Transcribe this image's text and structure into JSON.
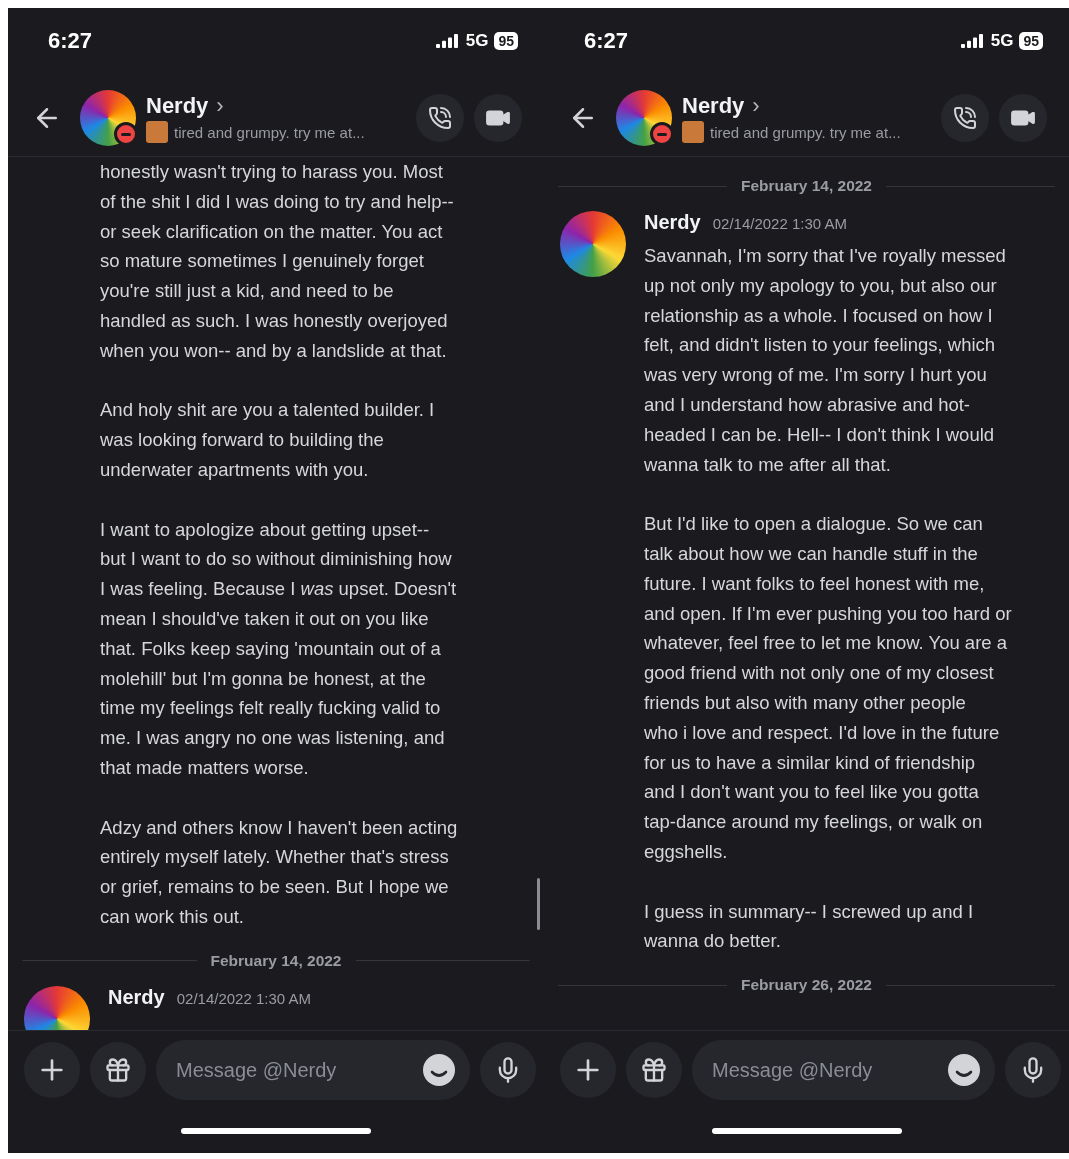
{
  "screens": [
    {
      "status_bar": {
        "time": "6:27",
        "network": "5G",
        "battery": "95"
      },
      "header": {
        "name": "Nerdy",
        "chevron": "›",
        "status": "tired and grumpy. try me at..."
      },
      "feed": [
        {
          "kind": "paragraphs",
          "paragraphs": [
            "honestly wasn't trying to harass you. Most\nof the shit I did I was doing to try and help--\nor seek clarification on the matter. You act\nso mature sometimes I genuinely forget\nyou're still just a kid, and need to be\nhandled as such. I was honestly overjoyed\nwhen you won-- and by a landslide at that.",
            "And holy shit are you a talented builder. I\nwas looking forward to building the\nunderwater apartments with you.",
            "I want to apologize about getting upset--\nbut I want to do so without diminishing how\nI was feeling. Because I *was* upset. Doesn't\nmean I should've taken it out on you like\nthat. Folks keep saying 'mountain out of a\nmolehill' but I'm gonna be honest, at the\ntime my feelings felt really fucking valid to\nme. I was angry no one was listening, and\nthat made matters worse.",
            "Adzy and others know I haven't been acting\nentirely myself lately. Whether that's stress\nor grief, remains to be seen. But I hope we\ncan work this out."
          ]
        },
        {
          "kind": "divider",
          "date": "February 14, 2022"
        },
        {
          "kind": "message",
          "author": "Nerdy",
          "timestamp": "02/14/2022 1:30 AM"
        }
      ],
      "composer": {
        "placeholder": "Message @Nerdy"
      }
    },
    {
      "status_bar": {
        "time": "6:27",
        "network": "5G",
        "battery": "95"
      },
      "header": {
        "name": "Nerdy",
        "chevron": "›",
        "status": "tired and grumpy. try me at..."
      },
      "feed": [
        {
          "kind": "divider",
          "date": "February 14, 2022"
        },
        {
          "kind": "message",
          "author": "Nerdy",
          "timestamp": "02/14/2022 1:30 AM",
          "paragraphs": [
            "Savannah, I'm sorry that I've royally messed\nup not only my apology to you, but also our\nrelationship as a whole. I focused on how I\nfelt, and didn't listen to your feelings, which\nwas very wrong of me. I'm sorry I hurt you\nand I understand how abrasive and hot-\nheaded I can be. Hell-- I don't think I would\nwanna talk to me after all that.",
            "But I'd like to open a dialogue. So we can\ntalk about how we can handle stuff in the\nfuture. I want folks to feel honest with me,\nand open. If I'm ever pushing you too hard or\nwhatever, feel free to let me know. You are a\ngood friend with not only one of my closest\nfriends but also with many other people\nwho i love and respect. I'd love in the future\nfor us to have a similar kind of friendship\nand I don't want you to feel like you gotta\ntap-dance around my feelings, or walk on\neggshells.",
            "I guess in summary-- I screwed up and I\nwanna do better."
          ]
        },
        {
          "kind": "divider",
          "date": "February 26, 2022"
        }
      ],
      "composer": {
        "placeholder": "Message @Nerdy"
      }
    }
  ]
}
